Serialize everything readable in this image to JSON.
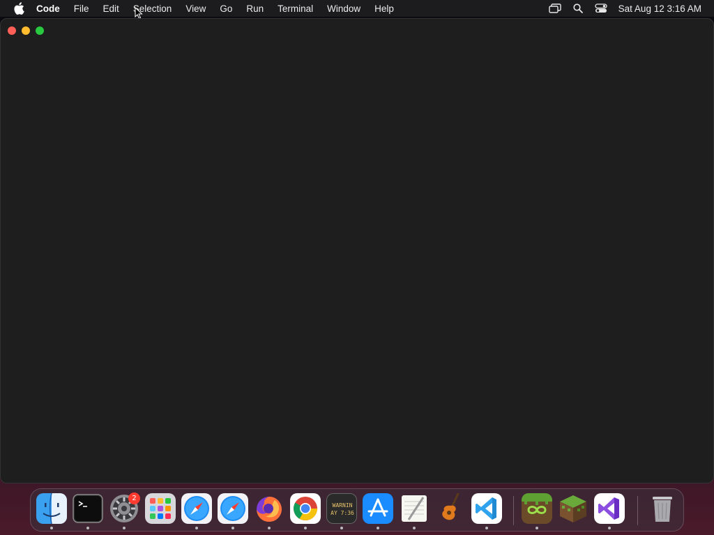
{
  "menubar": {
    "app_name": "Code",
    "items": [
      "File",
      "Edit",
      "Selection",
      "View",
      "Go",
      "Run",
      "Terminal",
      "Window",
      "Help"
    ],
    "clock": "Sat Aug 12  3:16 AM",
    "status_icons": [
      "screen-mirroring-icon",
      "search-icon",
      "control-center-icon"
    ]
  },
  "window": {
    "traffic_lights": [
      "close",
      "minimize",
      "maximize"
    ]
  },
  "dock": {
    "apps": [
      {
        "name": "Finder",
        "icon": "finder-icon"
      },
      {
        "name": "Terminal",
        "icon": "terminal-icon"
      },
      {
        "name": "System Settings",
        "icon": "system-settings-icon",
        "badge": "2"
      },
      {
        "name": "Launchpad",
        "icon": "launchpad-icon"
      },
      {
        "name": "Safari",
        "icon": "safari-icon"
      },
      {
        "name": "Safari",
        "icon": "safari-icon"
      },
      {
        "name": "Firefox",
        "icon": "firefox-icon"
      },
      {
        "name": "Google Chrome",
        "icon": "chrome-icon"
      },
      {
        "name": "Console",
        "icon": "console-icon",
        "text_line1": "WARNIN",
        "text_line2": "AY 7:36"
      },
      {
        "name": "App Store",
        "icon": "app-store-icon"
      },
      {
        "name": "TextEdit",
        "icon": "textedit-icon"
      },
      {
        "name": "GarageBand",
        "icon": "garageband-icon"
      },
      {
        "name": "Visual Studio Code",
        "icon": "vscode-icon"
      },
      {
        "name": "Minecraft Launcher",
        "icon": "minecraft-launcher-icon"
      },
      {
        "name": "Minecraft",
        "icon": "minecraft-icon"
      },
      {
        "name": "Visual Studio",
        "icon": "visual-studio-icon"
      },
      {
        "name": "Trash",
        "icon": "trash-icon"
      }
    ]
  },
  "colors": {
    "menubar_bg": "#1c1c1e",
    "window_bg": "#1e1e1e",
    "close": "#ff5f57",
    "minimize": "#febc2e",
    "maximize": "#28c840"
  }
}
